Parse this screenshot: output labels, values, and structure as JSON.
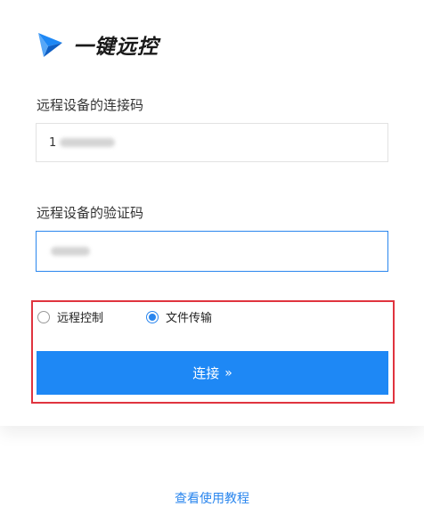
{
  "brand": {
    "name": "一键远控",
    "accent_color": "#1e88f5"
  },
  "form": {
    "connection_code": {
      "label": "远程设备的连接码",
      "value_prefix": "1"
    },
    "verification_code": {
      "label": "远程设备的验证码"
    },
    "mode": {
      "options": [
        {
          "label": "远程控制",
          "selected": false
        },
        {
          "label": "文件传输",
          "selected": true
        }
      ]
    },
    "connect_button": {
      "label": "连接",
      "icon": "double-chevron-right-icon",
      "icon_glyph": "»"
    }
  },
  "footer": {
    "tutorial_link": "查看使用教程"
  },
  "highlight_color": "#e0343f"
}
